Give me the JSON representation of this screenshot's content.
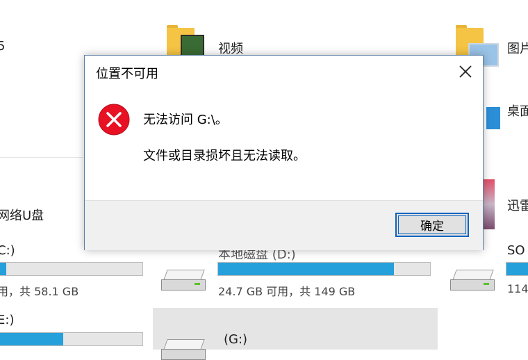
{
  "explorer": {
    "video_folder_label": "视频",
    "pictures_folder_label": "图片",
    "desktop_folder_label": "桌面",
    "network_drive_label": "网络U盘",
    "xunlei_label": "迅雷",
    "drive_c": {
      "label": "C:)",
      "free_text": "用，共 58.1 GB",
      "used_fraction": 0.06
    },
    "drive_d": {
      "label": "本地磁盘 (D:)",
      "free_text": "24.7 GB 可用，共 149 GB",
      "used_fraction": 0.83
    },
    "drive_right": {
      "label": "SO",
      "free_text": "114",
      "used_fraction": 0.85
    },
    "drive_bottom_left": {
      "label": "E:)",
      "used_fraction": 0.45
    },
    "drive_g": {
      "label": "(G:)"
    }
  },
  "dialog": {
    "title": "位置不可用",
    "message_line1": "无法访问 G:\\。",
    "message_line2": "文件或目录损坏且无法读取。",
    "ok_label": "确定"
  },
  "colors": {
    "accent": "#0a64c0",
    "progress": "#26a0da",
    "error_red": "#e81123"
  },
  "icons": [
    "folder-icon",
    "drive-icon",
    "error-icon",
    "close-icon"
  ]
}
